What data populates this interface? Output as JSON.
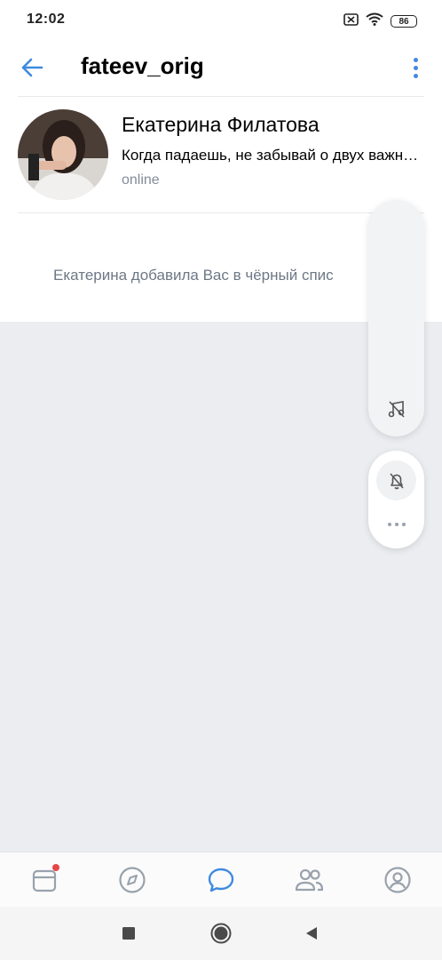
{
  "status_bar": {
    "time": "12:02",
    "battery": "86"
  },
  "header": {
    "title": "fateev_orig"
  },
  "profile": {
    "name": "Екатерина Филатова",
    "status": "Когда падаешь, не забывай о двух важных вещах",
    "online": "online"
  },
  "message": {
    "text": "Екатерина добавила Вас в чёрный спис"
  },
  "bottom_nav": {
    "items": [
      "news-icon",
      "explore-icon",
      "messages-icon",
      "friends-icon",
      "profile-icon"
    ],
    "active": "messages-icon"
  },
  "colors": {
    "accent": "#3f8ae0",
    "background": "#ebedf0",
    "badge": "#e64646",
    "secondary_text": "#818c99"
  }
}
